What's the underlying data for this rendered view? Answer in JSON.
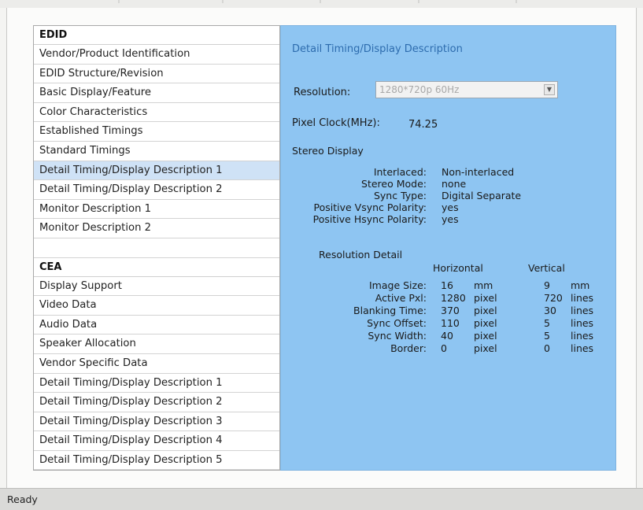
{
  "sidebar": {
    "edid_header": "EDID",
    "edid_items": [
      {
        "label": "Vendor/Product Identification"
      },
      {
        "label": "EDID Structure/Revision"
      },
      {
        "label": "Basic Display/Feature"
      },
      {
        "label": "Color Characteristics"
      },
      {
        "label": "Established Timings"
      },
      {
        "label": "Standard Timings"
      },
      {
        "label": "Detail Timing/Display Description 1",
        "selected": true
      },
      {
        "label": "Detail Timing/Display Description 2"
      },
      {
        "label": "Monitor Description 1"
      },
      {
        "label": "Monitor Description 2"
      }
    ],
    "cea_header": "CEA",
    "cea_items": [
      {
        "label": "Display Support"
      },
      {
        "label": "Video Data"
      },
      {
        "label": "Audio Data"
      },
      {
        "label": "Speaker Allocation"
      },
      {
        "label": "Vendor Specific Data"
      },
      {
        "label": "Detail Timing/Display Description 1"
      },
      {
        "label": "Detail Timing/Display Description 2"
      },
      {
        "label": "Detail Timing/Display Description 3"
      },
      {
        "label": "Detail Timing/Display Description 4"
      },
      {
        "label": "Detail Timing/Display Description 5"
      }
    ]
  },
  "detail": {
    "heading": "Detail Timing/Display Description",
    "resolution_label": "Resolution:",
    "resolution_value": "1280*720p 60Hz",
    "pixel_clock_label": "Pixel Clock(MHz):",
    "pixel_clock_value": "74.25",
    "stereo_label": "Stereo Display",
    "stereo": [
      {
        "label": "Interlaced:",
        "value": "Non-interlaced"
      },
      {
        "label": "Stereo Mode:",
        "value": "none"
      },
      {
        "label": "Sync Type:",
        "value": "Digital Separate"
      },
      {
        "label": "Positive Vsync Polarity:",
        "value": "yes"
      },
      {
        "label": "Positive Hsync Polarity:",
        "value": "yes"
      }
    ],
    "res_detail_title": "Resolution Detail",
    "horizontal_head": "Horizontal",
    "vertical_head": "Vertical",
    "rows": [
      {
        "label": "Image Size:",
        "h": "16",
        "hu": "mm",
        "v": "9",
        "vu": "mm"
      },
      {
        "label": "Active Pxl:",
        "h": "1280",
        "hu": "pixel",
        "v": "720",
        "vu": "lines"
      },
      {
        "label": "Blanking Time:",
        "h": "370",
        "hu": "pixel",
        "v": "30",
        "vu": "lines"
      },
      {
        "label": "Sync Offset:",
        "h": "110",
        "hu": "pixel",
        "v": "5",
        "vu": "lines"
      },
      {
        "label": "Sync Width:",
        "h": "40",
        "hu": "pixel",
        "v": "5",
        "vu": "lines"
      },
      {
        "label": "Border:",
        "h": "0",
        "hu": "pixel",
        "v": "0",
        "vu": "lines"
      }
    ]
  },
  "status": {
    "text": "Ready"
  },
  "colors": {
    "panel_bg": "#8ec5f2",
    "heading": "#2d6cae",
    "selected_row": "#cfe2f6"
  }
}
